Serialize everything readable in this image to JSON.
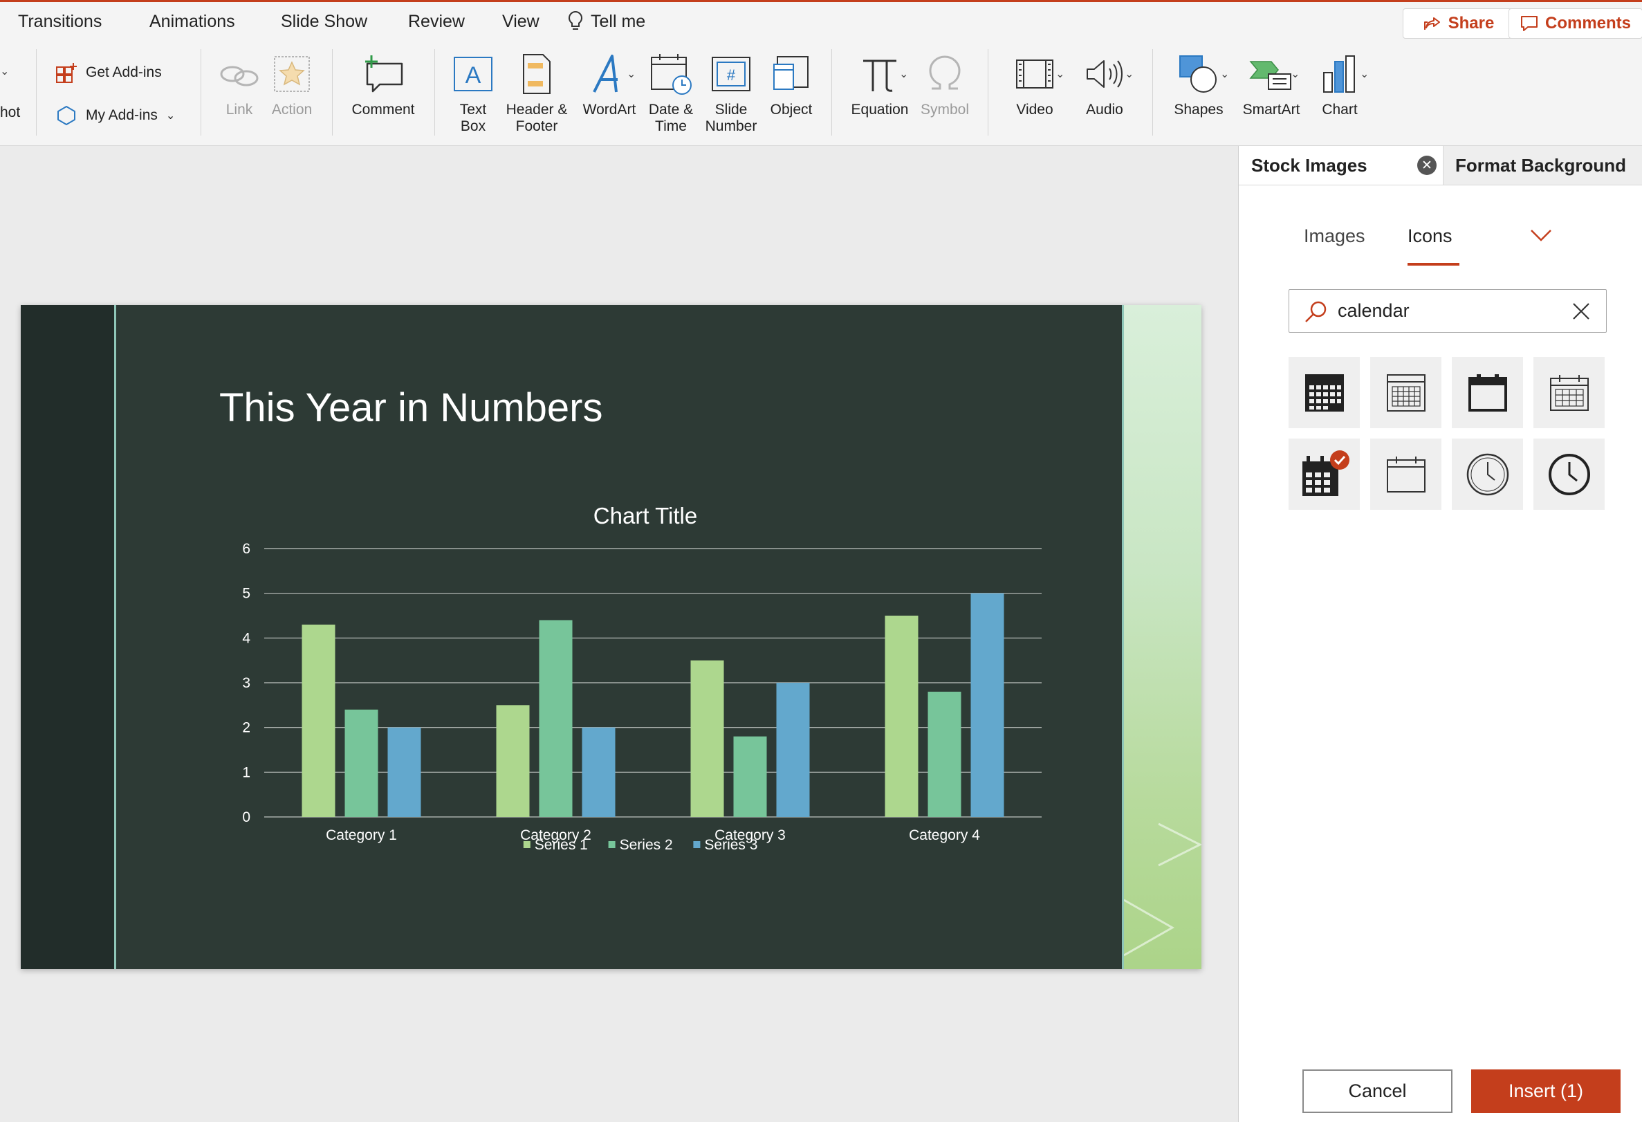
{
  "menubar": {
    "items": [
      "Transitions",
      "Animations",
      "Slide Show",
      "Review",
      "View"
    ],
    "tell_me": "Tell me",
    "share_label": "Share",
    "comments_label": "Comments"
  },
  "ribbon": {
    "cut_off_label": "hot",
    "get_addins": "Get Add-ins",
    "my_addins": "My Add-ins",
    "link": "Link",
    "action": "Action",
    "comment": "Comment",
    "text_box": [
      "Text",
      "Box"
    ],
    "header_footer": [
      "Header &",
      "Footer"
    ],
    "wordart": "WordArt",
    "date_time": [
      "Date &",
      "Time"
    ],
    "slide_number": [
      "Slide",
      "Number"
    ],
    "object": "Object",
    "equation": "Equation",
    "symbol": "Symbol",
    "video": "Video",
    "audio": "Audio",
    "shapes": "Shapes",
    "smartart": "SmartArt",
    "chart": "Chart"
  },
  "slide": {
    "title": "This Year in Numbers"
  },
  "chart_data": {
    "type": "bar",
    "title": "Chart Title",
    "categories": [
      "Category 1",
      "Category 2",
      "Category 3",
      "Category 4"
    ],
    "series": [
      {
        "name": "Series 1",
        "values": [
          4.3,
          2.5,
          3.5,
          4.5
        ],
        "color": "#add78e"
      },
      {
        "name": "Series 2",
        "values": [
          2.4,
          4.4,
          1.8,
          2.8
        ],
        "color": "#77c59a"
      },
      {
        "name": "Series 3",
        "values": [
          2,
          2,
          3,
          5
        ],
        "color": "#63a8cd"
      }
    ],
    "ylim": [
      0,
      6
    ],
    "yticks": [
      0,
      1,
      2,
      3,
      4,
      5,
      6
    ],
    "grid": true,
    "legend": "bottom"
  },
  "pane": {
    "tab_stock": "Stock Images",
    "tab_format": "Format Background",
    "subtab_images": "Images",
    "subtab_icons": "Icons",
    "search_value": "calendar",
    "cancel_label": "Cancel",
    "insert_label": "Insert (1)",
    "accent_color": "#c43e1c"
  }
}
